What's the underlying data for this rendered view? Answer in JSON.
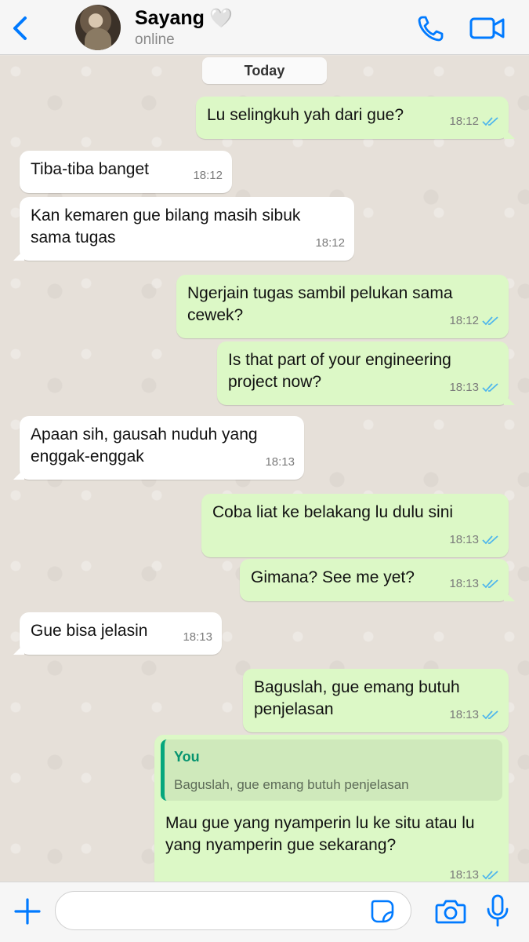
{
  "header": {
    "contact_name": "Sayang",
    "heart": "🤍",
    "status": "online",
    "icons": {
      "back": "chevron-left-icon",
      "call": "phone-icon",
      "video": "video-camera-icon"
    },
    "accent_color": "#007aff"
  },
  "chat": {
    "date_label": "Today",
    "messages": [
      {
        "dir": "out",
        "text": "Lu selingkuh yah dari gue?",
        "time": "18:12",
        "read": true
      },
      {
        "dir": "in",
        "text": "Tiba-tiba banget",
        "time": "18:12"
      },
      {
        "dir": "in",
        "text": "Kan kemaren gue bilang masih sibuk sama tugas",
        "time": "18:12"
      },
      {
        "dir": "out",
        "text": "Ngerjain tugas sambil pelukan sama cewek?",
        "time": "18:12",
        "read": true
      },
      {
        "dir": "out",
        "text": "Is that part of your engineering project now?",
        "time": "18:13",
        "read": true
      },
      {
        "dir": "in",
        "text": "Apaan sih, gausah nuduh yang enggak-enggak",
        "time": "18:13"
      },
      {
        "dir": "out",
        "text": "Coba liat ke belakang lu dulu sini",
        "time": "18:13",
        "read": true
      },
      {
        "dir": "out",
        "text": "Gimana? See me yet?",
        "time": "18:13",
        "read": true
      },
      {
        "dir": "in",
        "text": "Gue bisa jelasin",
        "time": "18:13"
      },
      {
        "dir": "out",
        "text": "Baguslah, gue emang butuh penjelasan",
        "time": "18:13",
        "read": true
      },
      {
        "dir": "out",
        "text": "Mau gue yang nyamperin lu ke situ atau lu yang nyamperin gue sekarang?",
        "time": "18:13",
        "read": true,
        "quote": {
          "author": "You",
          "text": "Baguslah, gue emang butuh penjelasan"
        }
      }
    ],
    "colors": {
      "outgoing": "#dcf8c6",
      "incoming": "#ffffff",
      "read_ticks": "#4fb6ec",
      "quote_author": "#07946f"
    }
  },
  "input_bar": {
    "placeholder": "",
    "icons": {
      "plus": "plus-icon",
      "sticker": "sticker-icon",
      "camera": "camera-icon",
      "mic": "microphone-icon"
    }
  }
}
